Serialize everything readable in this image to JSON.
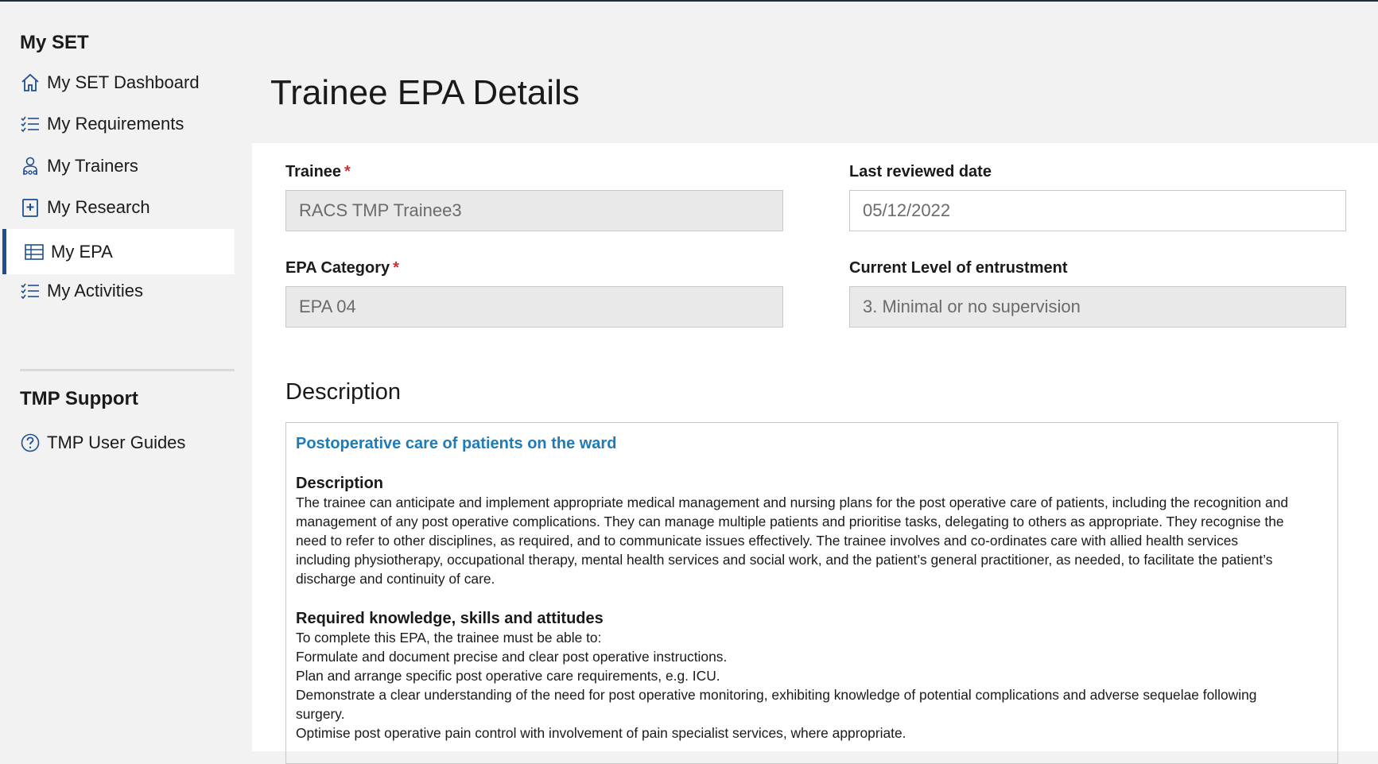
{
  "sidebar": {
    "section_title": "My SET",
    "items": [
      {
        "label": "My SET Dashboard",
        "icon": "home-icon"
      },
      {
        "label": "My Requirements",
        "icon": "checklist-icon"
      },
      {
        "label": "My Trainers",
        "icon": "people-icon"
      },
      {
        "label": "My Research",
        "icon": "add-document-icon"
      },
      {
        "label": "My EPA",
        "icon": "table-icon",
        "active": true
      },
      {
        "label": "My Activities",
        "icon": "checklist-icon"
      }
    ],
    "support_title": "TMP Support",
    "support_items": [
      {
        "label": "TMP User Guides",
        "icon": "help-circle-icon"
      }
    ]
  },
  "page_title": "Trainee EPA Details",
  "form": {
    "trainee": {
      "label": "Trainee",
      "required_mark": "*",
      "value": "RACS TMP Trainee3"
    },
    "last_reviewed": {
      "label": "Last reviewed date",
      "value": "05/12/2022"
    },
    "epa_category": {
      "label": "EPA Category",
      "required_mark": "*",
      "value": "EPA 04"
    },
    "entrustment": {
      "label": "Current Level of entrustment",
      "value": "3. Minimal or no supervision"
    }
  },
  "description": {
    "section_title": "Description",
    "epa_title": "Postoperative care of patients on the ward",
    "sub_description": "Description",
    "description_lines": [
      "The trainee can anticipate and implement appropriate medical management and nursing plans for the post operative care of patients, including the recognition and",
      "management of any post operative complications. They can manage multiple patients and prioritise tasks, delegating to others as appropriate. They recognise the",
      "need to refer to other disciplines, as required, and to communicate issues effectively.  The trainee involves and co-ordinates care with allied health services",
      "including physiotherapy, occupational therapy, mental health services and social work, and the patient’s general practitioner, as needed, to facilitate the patient’s",
      "discharge and continuity of care."
    ],
    "sub_ksa": "Required knowledge, skills and attitudes",
    "ksa_lines": [
      "To complete this EPA, the trainee must be able to:",
      "Formulate and document precise and clear post operative instructions.",
      "Plan and arrange specific post operative care requirements, e.g. ICU.",
      "Demonstrate a clear understanding of the need for post operative monitoring, exhibiting knowledge of potential complications and adverse sequelae following",
      "surgery.",
      "Optimise post operative pain control with involvement of pain specialist services, where appropriate."
    ]
  },
  "colors": {
    "accent": "#1d4f91",
    "link": "#1e7bb8",
    "required": "#d32f2f",
    "readonly_field": "#e9e9e9"
  }
}
